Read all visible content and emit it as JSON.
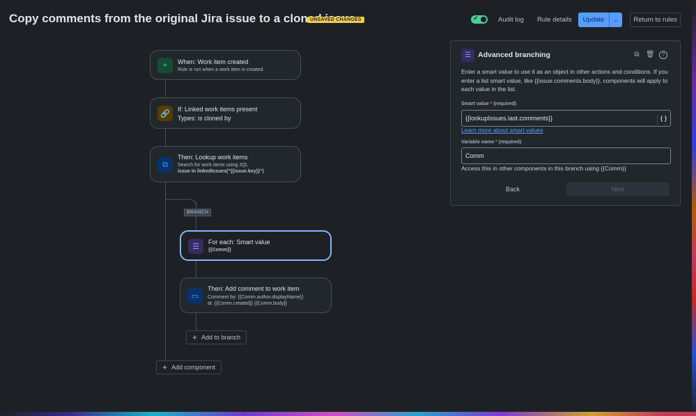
{
  "header": {
    "title": "Copy comments from the original Jira issue to a cloned issue",
    "badge": "UNSAVED CHANGES",
    "toggle_check": "✓",
    "audit_log": "Audit log",
    "rule_details": "Rule details",
    "update": "Update",
    "update_caret": "⌄",
    "return": "Return to rules"
  },
  "flow": {
    "trigger": {
      "title": "When: Work item created",
      "sub": "Rule is run when a work item is created.",
      "icon": "+"
    },
    "condition": {
      "title": "If: Linked work items present",
      "sub": "Types: is cloned by",
      "icon": "🔗"
    },
    "lookup": {
      "title": "Then: Lookup work items",
      "sub1": "Search for work items using JQL",
      "sub2": "issue in linkedIssues(\"{{issue.key}}\")",
      "icon": "⧉"
    },
    "branch_tag": "BRANCH",
    "for_each": {
      "title": "For each: Smart value",
      "sub": "{{Comm}}",
      "icon": "☰"
    },
    "add_comment": {
      "title": "Then: Add comment to work item",
      "sub1": "Comment by: {{Comm.author.displayName}}",
      "sub2": "at: {{Comm.created}} {{Comm.body}}",
      "icon": "▭"
    },
    "add_to_branch": "Add to branch",
    "add_component": "Add component",
    "plus": "+"
  },
  "panel": {
    "title": "Advanced branching",
    "icon": "☰",
    "tools": {
      "duplicate": "⧉",
      "delete": "🗑",
      "help": "?"
    },
    "description": "Enter a smart value to use it as an object in other actions and conditions. If you enter a list smart value, like {{issue.comments.body}}, components will apply to each value in the list.",
    "smart_value_label": "Smart value",
    "required_star": "*",
    "required_text": "(required)",
    "smart_value": "{{lookupIssues.last.comments}}",
    "braces": "{ }",
    "learn_more": "Learn more about smart values",
    "variable_name_label": "Variable name",
    "variable_name": "Comm",
    "access_text": "Access this in other components in this branch using {{Comm}}",
    "back": "Back",
    "next": "Next"
  },
  "colors": {
    "accent": "#579dff",
    "badge": "#f5cd47",
    "toggle": "#4bce97",
    "selected_border": "#85b8ff"
  }
}
